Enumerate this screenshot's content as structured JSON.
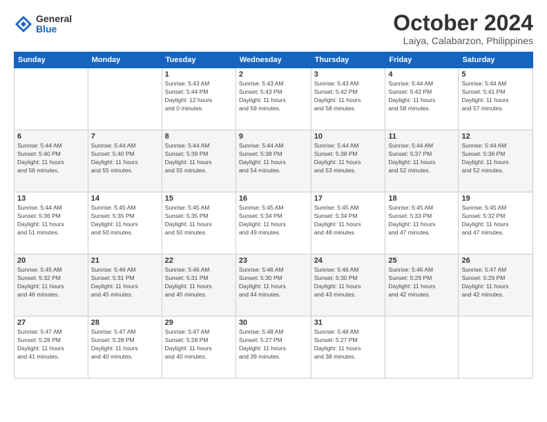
{
  "logo": {
    "general": "General",
    "blue": "Blue"
  },
  "header": {
    "title": "October 2024",
    "location": "Laiya, Calabarzon, Philippines"
  },
  "weekdays": [
    "Sunday",
    "Monday",
    "Tuesday",
    "Wednesday",
    "Thursday",
    "Friday",
    "Saturday"
  ],
  "weeks": [
    [
      {
        "day": "",
        "info": ""
      },
      {
        "day": "",
        "info": ""
      },
      {
        "day": "1",
        "info": "Sunrise: 5:43 AM\nSunset: 5:44 PM\nDaylight: 12 hours\nand 0 minutes."
      },
      {
        "day": "2",
        "info": "Sunrise: 5:43 AM\nSunset: 5:43 PM\nDaylight: 11 hours\nand 59 minutes."
      },
      {
        "day": "3",
        "info": "Sunrise: 5:43 AM\nSunset: 5:42 PM\nDaylight: 11 hours\nand 58 minutes."
      },
      {
        "day": "4",
        "info": "Sunrise: 5:44 AM\nSunset: 5:42 PM\nDaylight: 11 hours\nand 58 minutes."
      },
      {
        "day": "5",
        "info": "Sunrise: 5:44 AM\nSunset: 5:41 PM\nDaylight: 11 hours\nand 57 minutes."
      }
    ],
    [
      {
        "day": "6",
        "info": "Sunrise: 5:44 AM\nSunset: 5:40 PM\nDaylight: 11 hours\nand 56 minutes."
      },
      {
        "day": "7",
        "info": "Sunrise: 5:44 AM\nSunset: 5:40 PM\nDaylight: 11 hours\nand 55 minutes."
      },
      {
        "day": "8",
        "info": "Sunrise: 5:44 AM\nSunset: 5:39 PM\nDaylight: 11 hours\nand 55 minutes."
      },
      {
        "day": "9",
        "info": "Sunrise: 5:44 AM\nSunset: 5:38 PM\nDaylight: 11 hours\nand 54 minutes."
      },
      {
        "day": "10",
        "info": "Sunrise: 5:44 AM\nSunset: 5:38 PM\nDaylight: 11 hours\nand 53 minutes."
      },
      {
        "day": "11",
        "info": "Sunrise: 5:44 AM\nSunset: 5:37 PM\nDaylight: 11 hours\nand 52 minutes."
      },
      {
        "day": "12",
        "info": "Sunrise: 5:44 AM\nSunset: 5:36 PM\nDaylight: 11 hours\nand 52 minutes."
      }
    ],
    [
      {
        "day": "13",
        "info": "Sunrise: 5:44 AM\nSunset: 5:36 PM\nDaylight: 11 hours\nand 51 minutes."
      },
      {
        "day": "14",
        "info": "Sunrise: 5:45 AM\nSunset: 5:35 PM\nDaylight: 11 hours\nand 50 minutes."
      },
      {
        "day": "15",
        "info": "Sunrise: 5:45 AM\nSunset: 5:35 PM\nDaylight: 11 hours\nand 50 minutes."
      },
      {
        "day": "16",
        "info": "Sunrise: 5:45 AM\nSunset: 5:34 PM\nDaylight: 11 hours\nand 49 minutes."
      },
      {
        "day": "17",
        "info": "Sunrise: 5:45 AM\nSunset: 5:34 PM\nDaylight: 11 hours\nand 48 minutes."
      },
      {
        "day": "18",
        "info": "Sunrise: 5:45 AM\nSunset: 5:33 PM\nDaylight: 11 hours\nand 47 minutes."
      },
      {
        "day": "19",
        "info": "Sunrise: 5:45 AM\nSunset: 5:32 PM\nDaylight: 11 hours\nand 47 minutes."
      }
    ],
    [
      {
        "day": "20",
        "info": "Sunrise: 5:45 AM\nSunset: 5:32 PM\nDaylight: 11 hours\nand 46 minutes."
      },
      {
        "day": "21",
        "info": "Sunrise: 5:46 AM\nSunset: 5:31 PM\nDaylight: 11 hours\nand 45 minutes."
      },
      {
        "day": "22",
        "info": "Sunrise: 5:46 AM\nSunset: 5:31 PM\nDaylight: 11 hours\nand 45 minutes."
      },
      {
        "day": "23",
        "info": "Sunrise: 5:46 AM\nSunset: 5:30 PM\nDaylight: 11 hours\nand 44 minutes."
      },
      {
        "day": "24",
        "info": "Sunrise: 5:46 AM\nSunset: 5:30 PM\nDaylight: 11 hours\nand 43 minutes."
      },
      {
        "day": "25",
        "info": "Sunrise: 5:46 AM\nSunset: 5:29 PM\nDaylight: 11 hours\nand 42 minutes."
      },
      {
        "day": "26",
        "info": "Sunrise: 5:47 AM\nSunset: 5:29 PM\nDaylight: 11 hours\nand 42 minutes."
      }
    ],
    [
      {
        "day": "27",
        "info": "Sunrise: 5:47 AM\nSunset: 5:28 PM\nDaylight: 11 hours\nand 41 minutes."
      },
      {
        "day": "28",
        "info": "Sunrise: 5:47 AM\nSunset: 5:28 PM\nDaylight: 11 hours\nand 40 minutes."
      },
      {
        "day": "29",
        "info": "Sunrise: 5:47 AM\nSunset: 5:28 PM\nDaylight: 11 hours\nand 40 minutes."
      },
      {
        "day": "30",
        "info": "Sunrise: 5:48 AM\nSunset: 5:27 PM\nDaylight: 11 hours\nand 39 minutes."
      },
      {
        "day": "31",
        "info": "Sunrise: 5:48 AM\nSunset: 5:27 PM\nDaylight: 11 hours\nand 38 minutes."
      },
      {
        "day": "",
        "info": ""
      },
      {
        "day": "",
        "info": ""
      }
    ]
  ]
}
